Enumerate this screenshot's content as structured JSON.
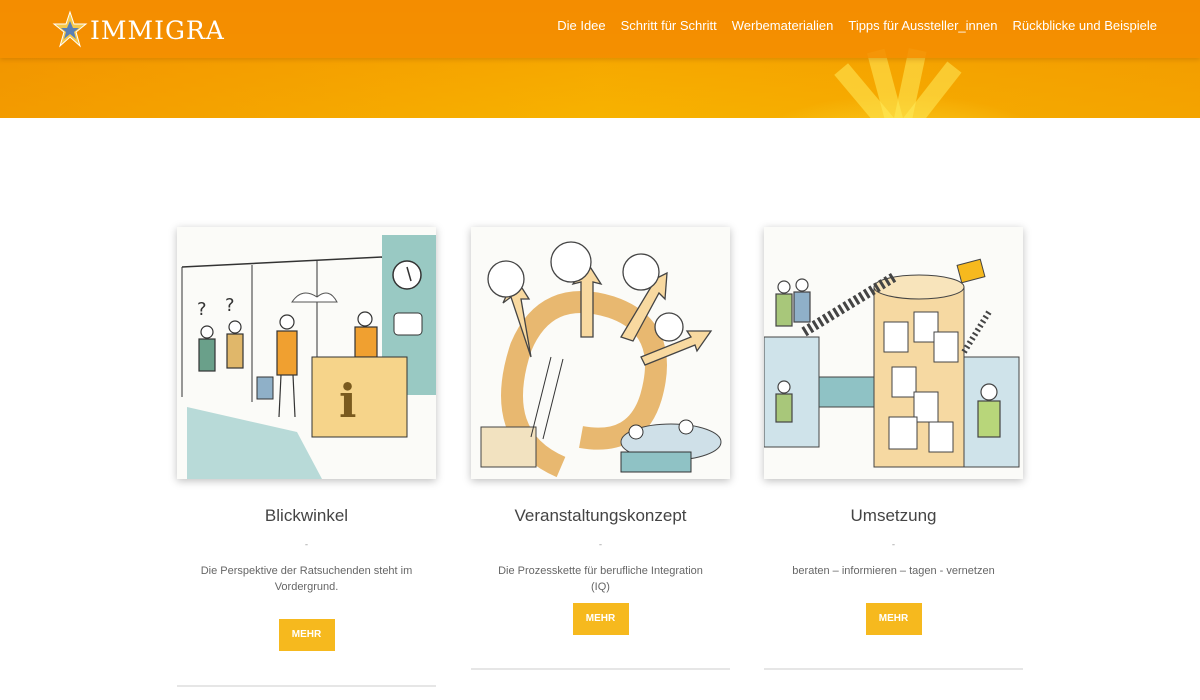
{
  "header": {
    "logo_text": "IMMIGRA",
    "nav": [
      "Die Idee",
      "Schritt für Schritt",
      "Werbematerialien",
      "Tipps für Aussteller_innen",
      "Rückblicke und Beispiele"
    ]
  },
  "cards": [
    {
      "title": "Blickwinkel",
      "dash": "-",
      "text": "Die Perspektive der Ratsuchenden steht im Vordergrund.",
      "button": "MEHR",
      "illustration": "info-desk-illustration"
    },
    {
      "title": "Veranstaltungskonzept",
      "dash": "-",
      "text": "Die Prozesskette für berufliche Integration (IQ)",
      "button": "MEHR",
      "illustration": "process-arrows-illustration"
    },
    {
      "title": "Umsetzung",
      "dash": "-",
      "text": "beraten – informieren – tagen - vernetzen",
      "button": "MEHR",
      "illustration": "networking-illustration"
    }
  ],
  "colors": {
    "header_orange": "#f39200",
    "button_yellow": "#f6b91e"
  }
}
